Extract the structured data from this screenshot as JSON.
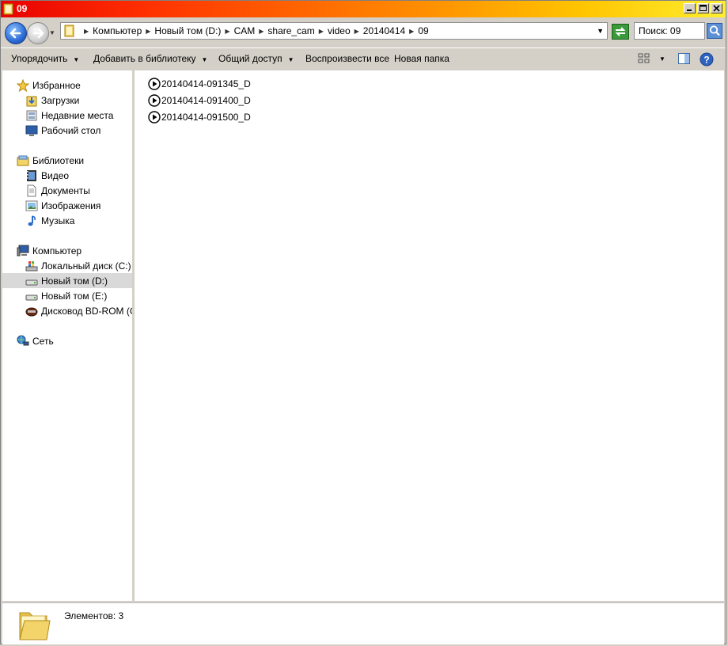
{
  "window": {
    "title": "09"
  },
  "address": {
    "crumbs": [
      "Компьютер",
      "Новый том (D:)",
      "CAM",
      "share_cam",
      "video",
      "20140414",
      "09"
    ]
  },
  "search": {
    "value": "Поиск: 09"
  },
  "toolbar": {
    "organize": "Упорядочить",
    "add_library": "Добавить в библиотеку",
    "share": "Общий доступ",
    "play_all": "Воспроизвести все",
    "new_folder": "Новая папка"
  },
  "nav": {
    "favorites": "Избранное",
    "downloads": "Загрузки",
    "recent": "Недавние места",
    "desktop": "Рабочий стол",
    "libraries": "Библиотеки",
    "video": "Видео",
    "documents": "Документы",
    "images": "Изображения",
    "music": "Музыка",
    "computer": "Компьютер",
    "drive_c": "Локальный диск (C:)",
    "drive_d": "Новый том (D:)",
    "drive_e": "Новый том (E:)",
    "drive_g": "Дисковод BD-ROM (G:)",
    "network": "Сеть"
  },
  "files": [
    {
      "name": "20140414-091345_D"
    },
    {
      "name": "20140414-091400_D"
    },
    {
      "name": "20140414-091500_D"
    }
  ],
  "status": {
    "count": "Элементов: 3"
  },
  "colors": {
    "title_gradient_start": "#e80000",
    "title_gradient_end": "#ffee30",
    "selected_bg": "#d9d9d9",
    "chrome": "#d4d0c8"
  }
}
